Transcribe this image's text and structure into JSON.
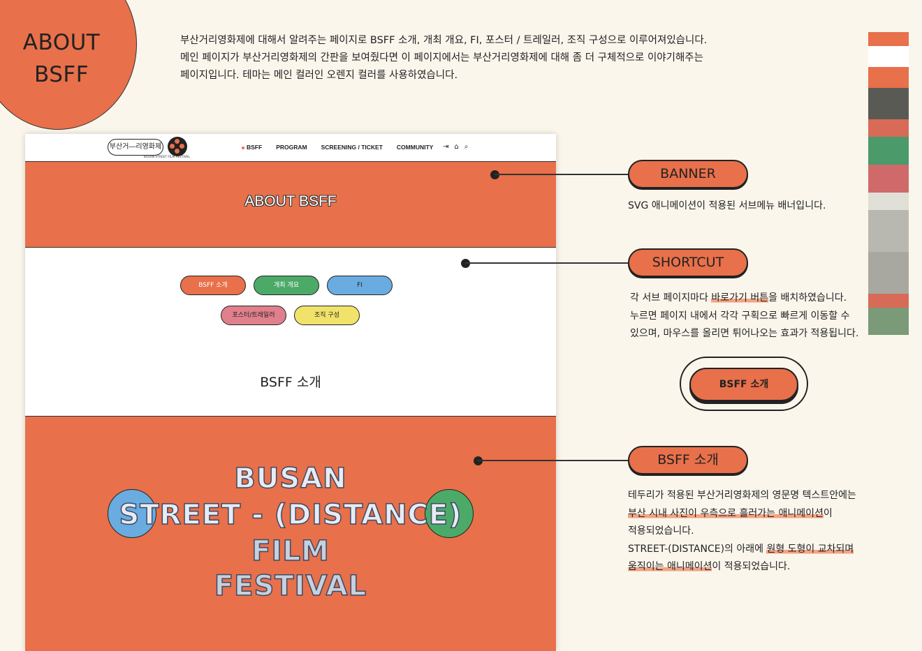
{
  "hero": {
    "line1": "ABOUT",
    "line2": "BSFF"
  },
  "intro": {
    "line1": "부산거리영화제에 대해서 알려주는 페이지로 BSFF 소개, 개최 개요, FI, 포스터 / 트레일러, 조직 구성으로 이루어져있습니다.",
    "line2": "메인 페이지가 부산거리영화제의 간판을 보여줬다면 이 페이지에서는 부산거리영화제에 대해 좀 더 구체적으로 이야기해주는",
    "line3": "페이지입니다. 테마는 메인 컬러인 오렌지 컬러를 사용하였습니다."
  },
  "mock": {
    "logo_text": "부산거―리영화제",
    "logo_sub": "BUSAN STREET FILM FESTIVAL",
    "nav": [
      "BSFF",
      "PROGRAM",
      "SCREENING / TICKET",
      "COMMUNITY"
    ],
    "nav_icons": [
      "⇥",
      "⌂",
      "⌕"
    ],
    "banner_title": "ABOUT BSFF",
    "pills": [
      "BSFF 소개",
      "개최 개요",
      "FI",
      "포스터/트레일러",
      "조직 구성"
    ],
    "section_heading": "BSFF 소개",
    "big_lines": [
      "BUSAN",
      "STREET - (DISTANCE)",
      "FILM",
      "FESTIVAL"
    ]
  },
  "annotations": {
    "banner": {
      "tag": "BANNER",
      "desc": "SVG 애니메이션이 적용된 서브메뉴 배너입니다."
    },
    "shortcut": {
      "tag": "SHORTCUT",
      "desc_1a": "각 서브 페이지마다 ",
      "desc_1b": "바로가기 버튼",
      "desc_1c": "을 배치하였습니다.",
      "desc_2": "누르면 페이지 내에서 각각 구획으로 빠르게 이동할 수",
      "desc_3": "있으며, 마우스를 올리면 튀어나오는 효과가 적용됩니다.",
      "demo_button": "BSFF 소개"
    },
    "bsff": {
      "tag": "BSFF 소개",
      "desc_1": "테두리가 적용된 부산거리영화제의 영문명 텍스트안에는",
      "desc_2a": "부산 시내 사진이 우측으로 흘러가는 애니메이션",
      "desc_2b": "이",
      "desc_3": "적용되었습니다.",
      "desc_4a": "STREET-(DISTANCE)의 아래에 ",
      "desc_4b": "원형 도형이 교차되며",
      "desc_5a": "움직이는 애니메이션",
      "desc_5b": "이 적용되었습니다."
    }
  },
  "colors": {
    "orange": "#e8704a",
    "green": "#4caa68",
    "blue": "#6aacdf",
    "pink": "#e0808c",
    "yellow": "#f1e36a",
    "cream": "#faf6ec"
  }
}
